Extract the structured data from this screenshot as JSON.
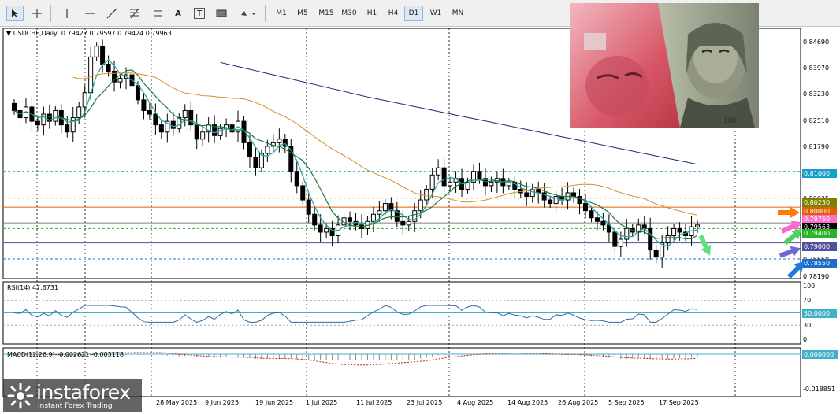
{
  "toolbar": {
    "periods": [
      "M1",
      "M5",
      "M15",
      "M30",
      "H1",
      "H4",
      "D1",
      "W1",
      "MN"
    ],
    "active_period": "D1",
    "tools": [
      "cursor-icon",
      "crosshair-icon",
      "vertical-line-icon",
      "horizontal-line-icon",
      "trendline-icon",
      "fibonacci-icon",
      "text-tool-icon",
      "text-label-icon",
      "rectangle-icon",
      "shapes-dropdown-icon"
    ],
    "text_tool_label": "A",
    "label_tool_label": "T"
  },
  "header": {
    "symbol": "USDCHF,Daily",
    "ohlc": "0.79427 0.79597 0.79424 0.79963"
  },
  "price_axis": [
    "0.84690",
    "0.83970",
    "0.83230",
    "0.82510",
    "0.81790",
    "0.80025",
    "0.79563",
    "0.78550",
    "0.78190"
  ],
  "price_tags": [
    {
      "text": "0.81000",
      "color": "#14a0c8"
    },
    {
      "text": "0.80250",
      "color": "#808000"
    },
    {
      "text": "0.80000",
      "color": "#e06000"
    },
    {
      "text": "0.79750",
      "color": "#ff6ec8"
    },
    {
      "text": "0.79563",
      "color": "#000000"
    },
    {
      "text": "0.79400",
      "color": "#28b428"
    },
    {
      "text": "0.79000",
      "color": "#5050a0"
    },
    {
      "text": "0.78550",
      "color": "#1e6ec8"
    }
  ],
  "arrows": [
    {
      "name": "orange-arrow-icon",
      "color": "#ff7a00"
    },
    {
      "name": "pink-arrow-icon",
      "color": "#ff64d0"
    },
    {
      "name": "green-arrow-icon",
      "color": "#50d060"
    },
    {
      "name": "purple-arrow-icon",
      "color": "#6a6ad0"
    },
    {
      "name": "blue-arrow-icon",
      "color": "#1e7ae0"
    },
    {
      "name": "light-green-arrow-icon",
      "color": "#60e080"
    }
  ],
  "rsi": {
    "label": "RSI(14) 47.6731",
    "axis": [
      "100",
      "70",
      "50.0000",
      "30",
      "0"
    ]
  },
  "macd": {
    "label": "MACD(12,26,9) -0.002621 -0.003118",
    "axis": [
      "0.000000",
      "-0.018851"
    ]
  },
  "dates": [
    "28 May 2025",
    "9 Jun 2025",
    "19 Jun 2025",
    "1 Jul 2025",
    "11 Jul 2025",
    "23 Jul 2025",
    "4 Aug 2025",
    "14 Aug 2025",
    "26 Aug 2025",
    "5 Sep 2025",
    "17 Sep 2025"
  ],
  "logo": {
    "brand": "instaforex",
    "tagline": "Instant Forex Trading"
  },
  "chart_data": {
    "type": "candlestick",
    "symbol": "USDCHF",
    "timeframe": "Daily",
    "ylim": [
      0.78,
      0.85
    ],
    "closes": [
      0.827,
      0.825,
      0.828,
      0.824,
      0.823,
      0.826,
      0.824,
      0.827,
      0.823,
      0.821,
      0.825,
      0.828,
      0.832,
      0.842,
      0.845,
      0.84,
      0.838,
      0.835,
      0.836,
      0.837,
      0.834,
      0.83,
      0.827,
      0.826,
      0.823,
      0.821,
      0.824,
      0.822,
      0.825,
      0.827,
      0.823,
      0.819,
      0.821,
      0.823,
      0.82,
      0.822,
      0.823,
      0.821,
      0.824,
      0.818,
      0.814,
      0.811,
      0.815,
      0.817,
      0.818,
      0.819,
      0.817,
      0.81,
      0.806,
      0.802,
      0.798,
      0.795,
      0.793,
      0.794,
      0.792,
      0.795,
      0.797,
      0.796,
      0.795,
      0.794,
      0.796,
      0.798,
      0.799,
      0.801,
      0.799,
      0.796,
      0.795,
      0.796,
      0.799,
      0.802,
      0.805,
      0.809,
      0.811,
      0.806,
      0.807,
      0.808,
      0.805,
      0.807,
      0.81,
      0.808,
      0.806,
      0.807,
      0.808,
      0.806,
      0.807,
      0.805,
      0.804,
      0.803,
      0.805,
      0.804,
      0.802,
      0.801,
      0.803,
      0.802,
      0.804,
      0.803,
      0.801,
      0.799,
      0.797,
      0.796,
      0.795,
      0.793,
      0.789,
      0.791,
      0.794,
      0.793,
      0.795,
      0.794,
      0.788,
      0.786,
      0.79,
      0.792,
      0.794,
      0.793,
      0.792,
      0.7945,
      0.795
    ],
    "indicators": [
      "MA fast (teal)",
      "MA medium (green)",
      "MA 50 (orange)",
      "MA 100 (navy)"
    ],
    "levels": [
      0.81,
      0.8025,
      0.8,
      0.7975,
      0.7956,
      0.794,
      0.79,
      0.7855
    ],
    "rsi_value": 47.6731,
    "rsi_levels": [
      70,
      50,
      30
    ],
    "macd_values": [
      -0.002621,
      -0.003118
    ]
  }
}
